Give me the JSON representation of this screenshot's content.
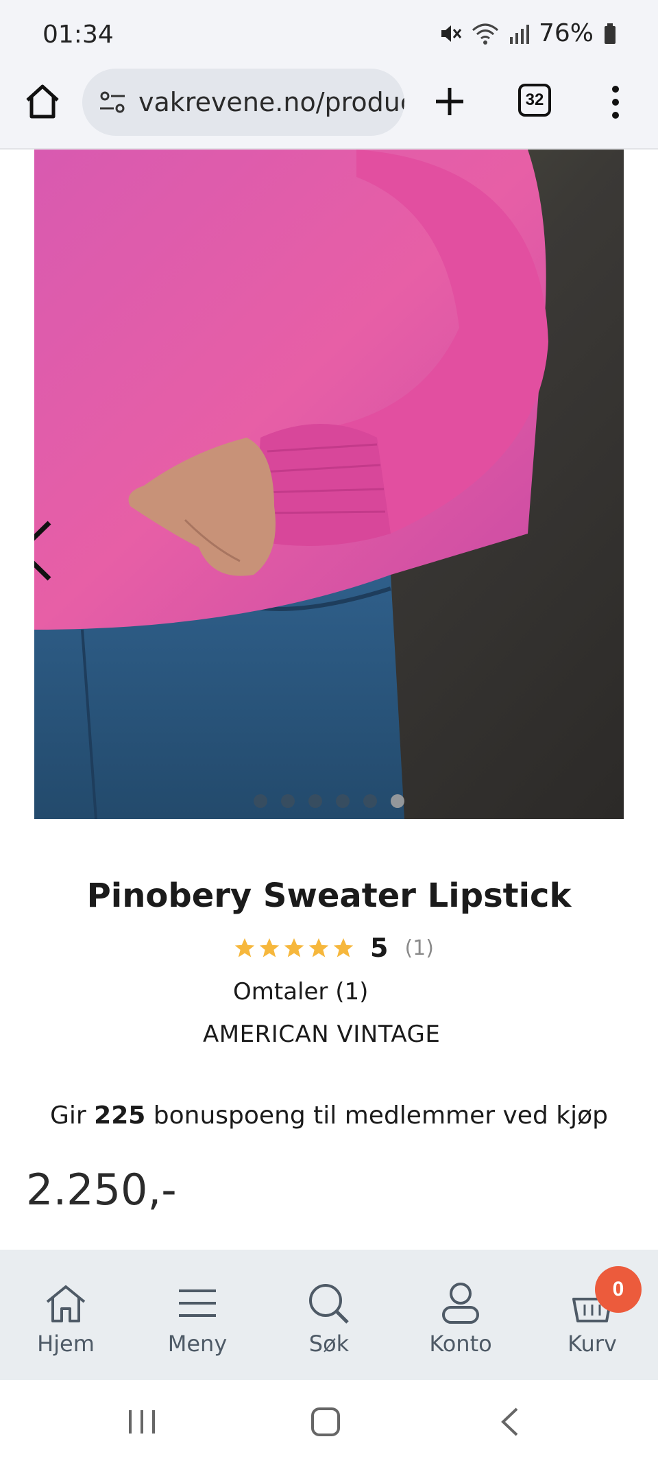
{
  "status_bar": {
    "time": "01:34",
    "battery": "76%"
  },
  "browser": {
    "url": "vakrevene.no/produc",
    "tab_count": "32"
  },
  "carousel": {
    "total_slides": 6,
    "active_index": 5
  },
  "product": {
    "title": "Pinobery Sweater Lipstick",
    "rating_score": "5",
    "rating_count": "(1)",
    "stars": 5,
    "reviews_link": "Omtaler (1)",
    "brand": "AMERICAN VINTAGE",
    "bonus_prefix": "Gir ",
    "bonus_points": "225",
    "bonus_suffix": " bonuspoeng til medlemmer ved kjøp",
    "price": "2.250,-"
  },
  "bottom_nav": {
    "items": [
      {
        "label": "Hjem",
        "icon": "home-icon"
      },
      {
        "label": "Meny",
        "icon": "menu-icon"
      },
      {
        "label": "Søk",
        "icon": "search-icon"
      },
      {
        "label": "Konto",
        "icon": "account-icon"
      },
      {
        "label": "Kurv",
        "icon": "basket-icon"
      }
    ],
    "cart_badge": "0"
  },
  "colors": {
    "star": "#f6b73c",
    "badge": "#ec5b3c",
    "nav_bg": "#e9edf0"
  }
}
